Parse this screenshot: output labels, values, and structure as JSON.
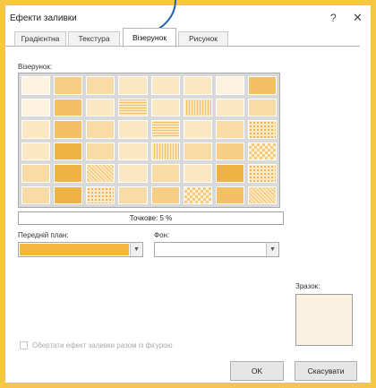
{
  "dialog": {
    "title": "Ефекти заливки",
    "help_glyph": "?",
    "close_glyph": "✕"
  },
  "tabs": [
    {
      "label": "Градієнтна",
      "active": false
    },
    {
      "label": "Текстура",
      "active": false
    },
    {
      "label": "Візерунок",
      "active": true
    },
    {
      "label": "Рисунок",
      "active": false
    }
  ],
  "pattern": {
    "section_label": "Візерунок:",
    "selected_name": "Точкове: 5 %"
  },
  "foreground": {
    "label": "Передній план:",
    "color": "#f4b63e"
  },
  "background": {
    "label": "Фон:",
    "color": "#ffffff"
  },
  "preview": {
    "label": "Зразок:",
    "color": "#fbf1e0"
  },
  "rotate_option": {
    "label": "Обертати ефект заливки разом із фігурою",
    "checked": false,
    "enabled": false
  },
  "buttons": {
    "ok": "OK",
    "cancel": "Скасувати"
  },
  "colors": {
    "frame_border": "#f6c744",
    "callout": "#1f5fb4",
    "accent_pattern": "#f4b63e"
  },
  "icons": {
    "dropdown": "chevron-down-icon",
    "help": "help-icon",
    "close": "close-icon"
  }
}
